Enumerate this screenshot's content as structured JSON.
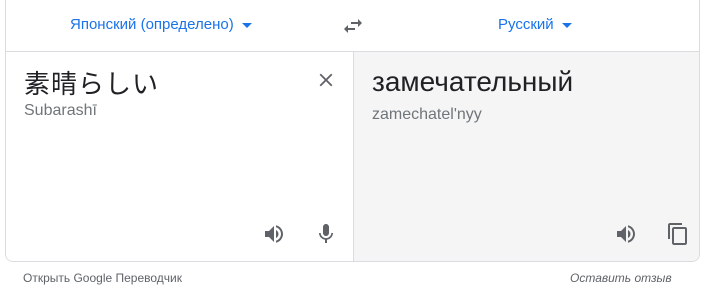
{
  "header": {
    "source_language": "Японский (определено)",
    "target_language": "Русский",
    "swap_icon": "swap-arrows-icon"
  },
  "source": {
    "text": "素晴らしい",
    "transliteration": "Subarashī",
    "icons": {
      "clear": "close-icon",
      "speak": "speaker-icon",
      "mic": "mic-icon"
    }
  },
  "target": {
    "text": "замечательный",
    "transliteration": "zamechatel'nyy",
    "icons": {
      "speak": "speaker-icon",
      "copy": "copy-icon"
    }
  },
  "footer": {
    "open_link": "Открыть Google Переводчик",
    "feedback": "Оставить отзыв"
  },
  "colors": {
    "accent": "#1a73e8",
    "icon": "#5f6368",
    "target_bg": "#f5f5f5",
    "border": "#dadce0"
  }
}
